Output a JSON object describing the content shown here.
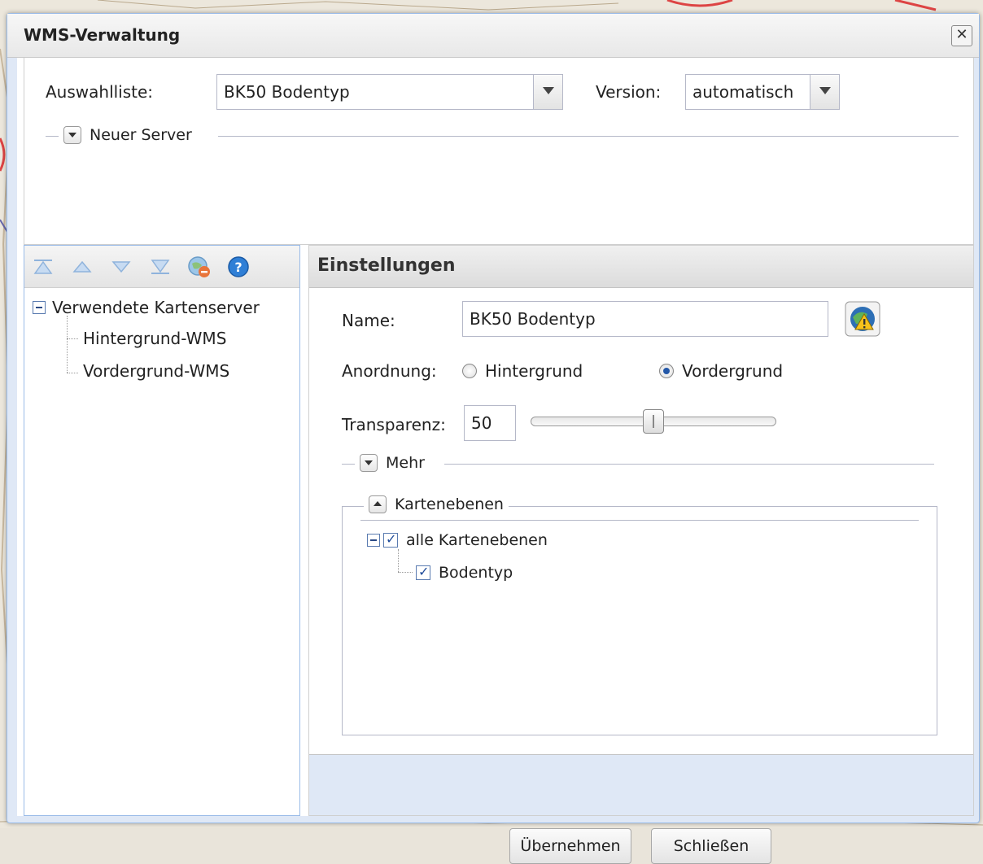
{
  "window": {
    "title": "WMS-Verwaltung",
    "close_icon": "close-icon"
  },
  "top": {
    "selection_label": "Auswahlliste:",
    "selection_value": "BK50 Bodentyp",
    "version_label": "Version:",
    "version_value": "automatisch",
    "new_server_label": "Neuer Server"
  },
  "left": {
    "toolbar_icons": [
      "move-top-icon",
      "move-up-icon",
      "move-down-icon",
      "move-bottom-icon",
      "remove-server-icon",
      "help-icon"
    ],
    "tree": {
      "root": "Verwendete Kartenserver",
      "children": [
        "Hintergrund-WMS",
        "Vordergrund-WMS"
      ]
    }
  },
  "settings": {
    "title": "Einstellungen",
    "name_label": "Name:",
    "name_value": "BK50 Bodentyp",
    "order_label": "Anordnung:",
    "order_options": [
      "Hintergrund",
      "Vordergrund"
    ],
    "order_selected": "Vordergrund",
    "transparency_label": "Transparenz:",
    "transparency_value": "50",
    "transparency_level": 0.5,
    "more_label": "Mehr",
    "layers_label": "Kartenebenen",
    "layers_all": "alle Kartenebenen",
    "layers": [
      "Bodentyp"
    ]
  },
  "footer": {
    "apply_label": "Übernehmen",
    "close_label": "Schließen"
  }
}
